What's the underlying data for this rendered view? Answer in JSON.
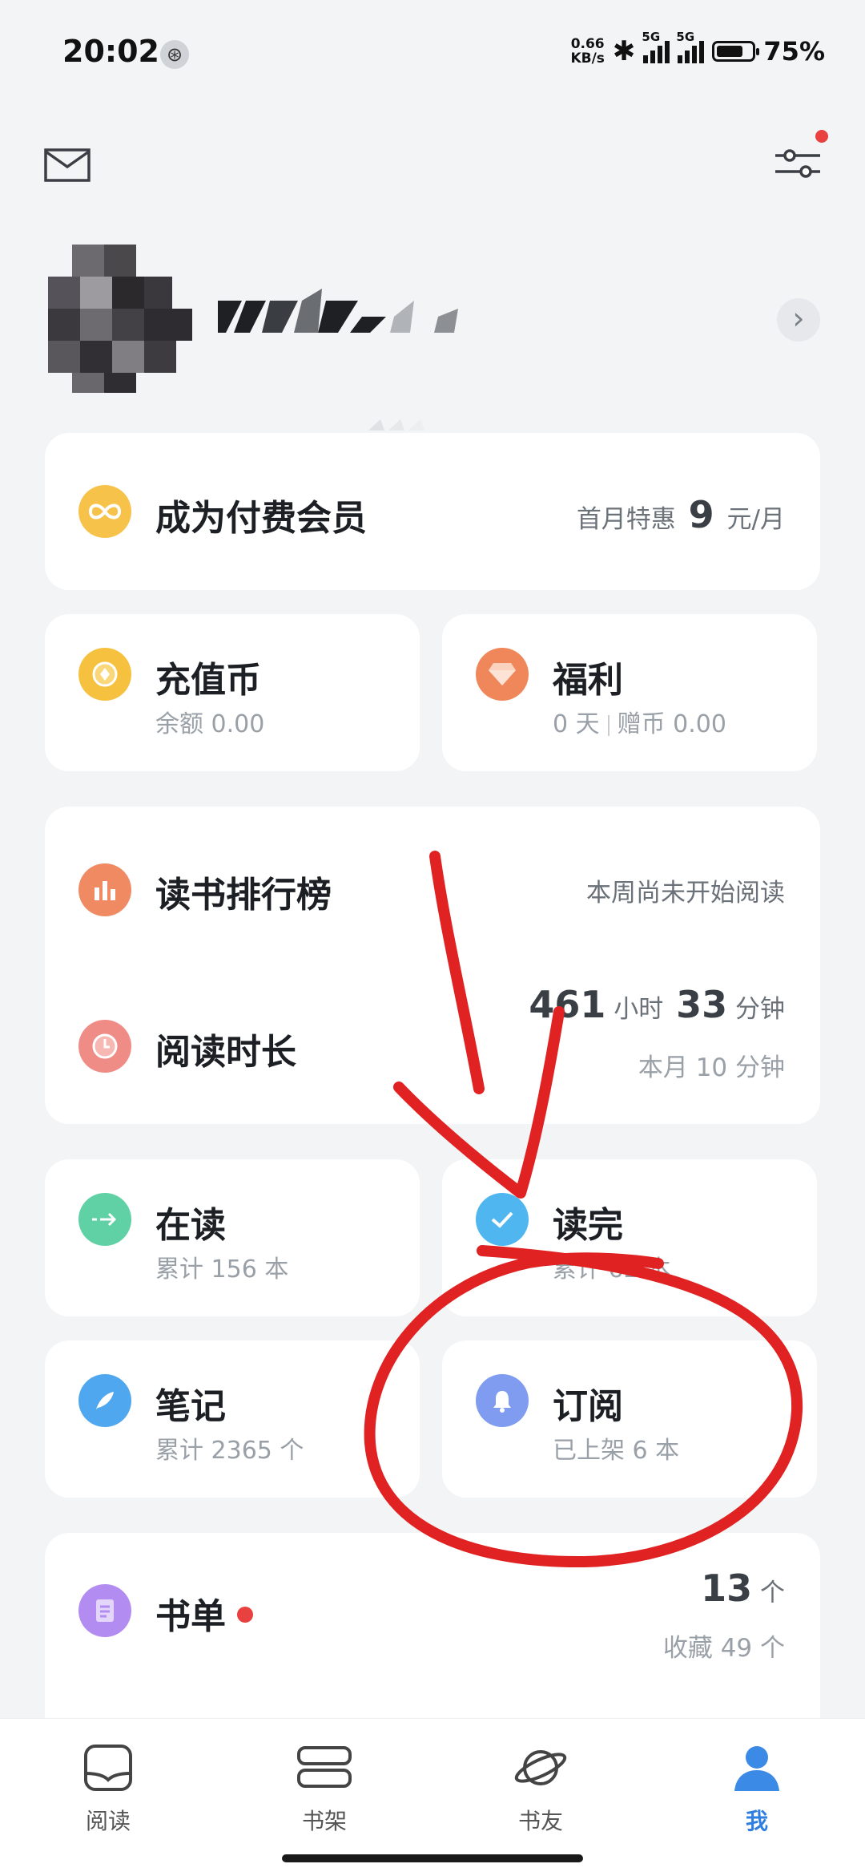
{
  "status_bar": {
    "time": "20:02",
    "net_speed_value": "0.66",
    "net_speed_unit": "KB/s",
    "sim1": "5G",
    "sim2": "5G",
    "battery": "75%",
    "battery_level": 0.75
  },
  "membership": {
    "title": "成为付费会员",
    "offer_prefix": "首月特惠",
    "offer_price": "9",
    "offer_suffix": "元/月"
  },
  "recharge": {
    "title": "充值币",
    "sub": "余额 0.00"
  },
  "welfare": {
    "title": "福利",
    "sub_days": "0 天",
    "sub_coins": "赠币 0.00"
  },
  "ranking": {
    "title": "读书排行榜",
    "status": "本周尚未开始阅读"
  },
  "reading_time": {
    "title": "阅读时长",
    "hours": "461",
    "hours_unit": "小时",
    "minutes": "33",
    "minutes_unit": "分钟",
    "month": "本月 10 分钟"
  },
  "reading": {
    "title": "在读",
    "sub": "累计 156 本"
  },
  "finished": {
    "title": "读完",
    "sub": "累计 62 本"
  },
  "notes": {
    "title": "笔记",
    "sub": "累计 2365 个"
  },
  "subscribe": {
    "title": "订阅",
    "sub": "已上架 6 本"
  },
  "booklist": {
    "title": "书单",
    "count": "13",
    "count_unit": "个",
    "collected": "收藏 49 个"
  },
  "bottom_nav": [
    {
      "label": "阅读",
      "icon": "book-open-icon"
    },
    {
      "label": "书架",
      "icon": "bookshelf-icon"
    },
    {
      "label": "书友",
      "icon": "planet-icon"
    },
    {
      "label": "我",
      "icon": "person-icon"
    }
  ],
  "colors": {
    "accent": "#2f7fe0",
    "annotation": "#e02222",
    "red_dot": "#e94040"
  }
}
